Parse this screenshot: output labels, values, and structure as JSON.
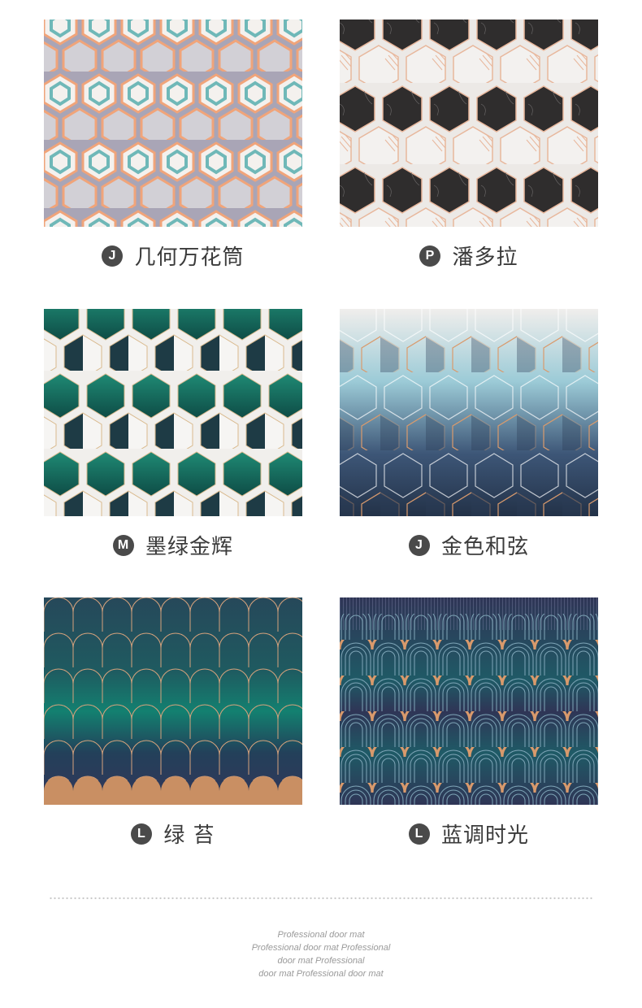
{
  "products": [
    {
      "badge": "J",
      "name": "几何万花筒",
      "pattern": "hex-kaleidoscope-icon"
    },
    {
      "badge": "P",
      "name": "潘多拉",
      "pattern": "hex-marble-icon"
    },
    {
      "badge": "M",
      "name": "墨绿金辉",
      "pattern": "hex-green-gold-icon"
    },
    {
      "badge": "J",
      "name": "金色和弦",
      "pattern": "hex-blue-gold-icon"
    },
    {
      "badge": "L",
      "name": "绿 苔",
      "pattern": "scale-green-icon"
    },
    {
      "badge": "L",
      "name": "蓝调时光",
      "pattern": "arch-blue-icon"
    }
  ],
  "footer": {
    "lines": [
      "Professional door mat",
      "Professional door mat Professional",
      "door mat Professional",
      "door mat Professional door mat"
    ]
  },
  "colors": {
    "badge": "#4a4a4a",
    "caption_text": "#3b3b3b",
    "footer_text": "#9a9a9a"
  }
}
